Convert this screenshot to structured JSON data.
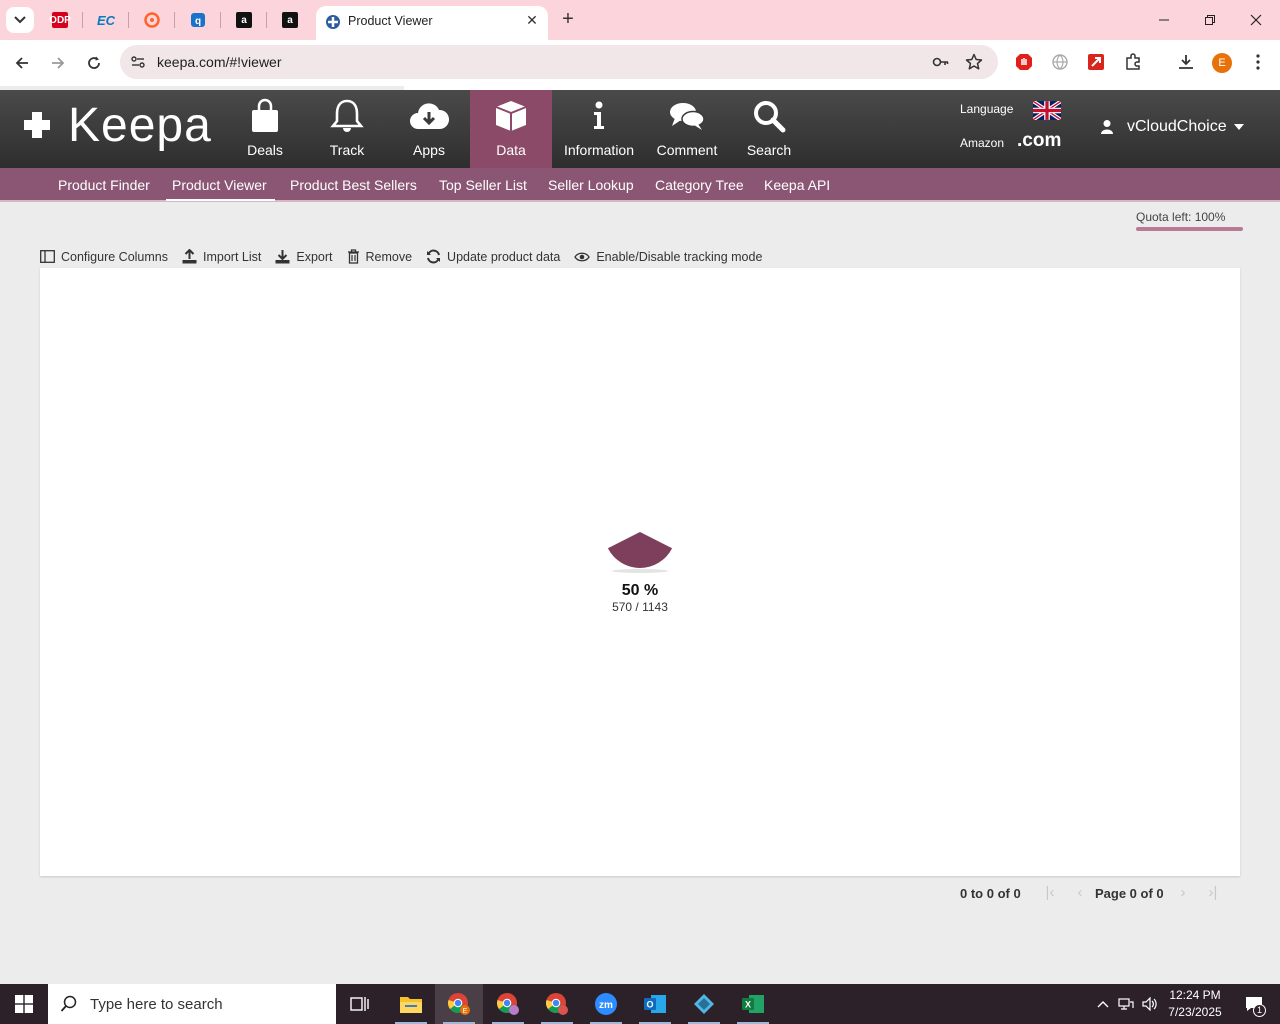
{
  "browser": {
    "active_tab_title": "Product Viewer",
    "url": "keepa.com/#!viewer",
    "profile_initial": "E",
    "pinned_tabs": [
      "office-depot",
      "ec",
      "semrush",
      "keepa",
      "amazon",
      "amazon"
    ]
  },
  "keepa": {
    "logo": "Keepa",
    "menu": [
      {
        "label": "Deals",
        "icon": "shopping-bag-icon"
      },
      {
        "label": "Track",
        "icon": "bell-icon"
      },
      {
        "label": "Apps",
        "icon": "cloud-download-icon"
      },
      {
        "label": "Data",
        "icon": "box-icon",
        "active": true
      },
      {
        "label": "Information",
        "icon": "info-icon"
      },
      {
        "label": "Comment",
        "icon": "comments-icon"
      },
      {
        "label": "Search",
        "icon": "magnifier-icon"
      }
    ],
    "language_label": "Language",
    "amazon_label": "Amazon",
    "domain": ".com",
    "username": "vCloudChoice",
    "subnav": [
      "Product Finder",
      "Product Viewer",
      "Product Best Sellers",
      "Top Seller List",
      "Seller Lookup",
      "Category Tree",
      "Keepa API"
    ],
    "subnav_active": "Product Viewer",
    "accent_color": "#8b5674"
  },
  "viewer": {
    "quota": "Quota left: 100%",
    "actions": {
      "configure": "Configure Columns",
      "import": "Import List",
      "export": "Export",
      "remove": "Remove",
      "update": "Update product data",
      "tracking": "Enable/Disable tracking mode"
    },
    "loading": {
      "percent_text": "50 %",
      "count_text": "570 / 1143",
      "progress": 0.5
    },
    "pager": {
      "range": "0 to 0 of 0",
      "page_text": "Page 0 of 0"
    }
  },
  "taskbar": {
    "search_placeholder": "Type here to search",
    "time": "12:24 PM",
    "date": "7/23/2025",
    "notification_count": "1"
  }
}
